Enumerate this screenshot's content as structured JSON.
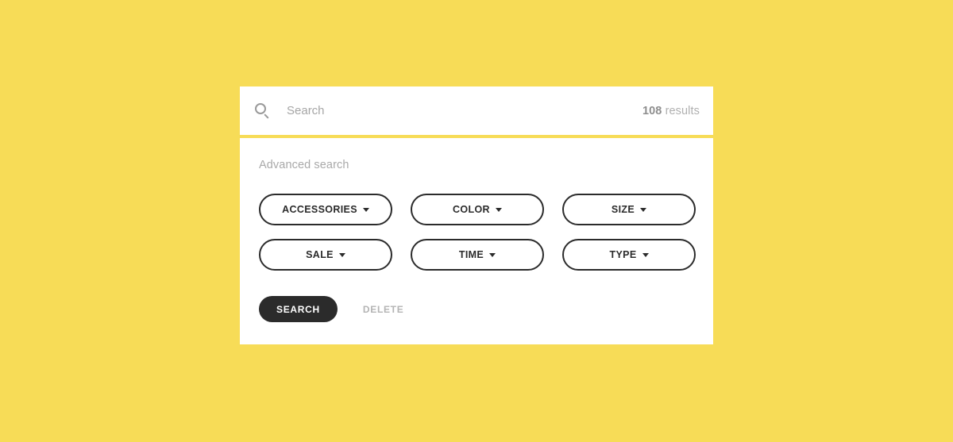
{
  "theme": {
    "background_color": "#f7dc57",
    "card_color": "#ffffff",
    "accent_dark": "#2b2b2b",
    "muted_text": "#a9a9a9"
  },
  "search": {
    "icon": "search-icon",
    "placeholder": "Search",
    "value": "",
    "results_count": "108",
    "results_label": "results"
  },
  "advanced": {
    "title": "Advanced search",
    "filters": [
      {
        "label": "ACCESSORIES",
        "icon": "chevron-down-icon"
      },
      {
        "label": "COLOR",
        "icon": "chevron-down-icon"
      },
      {
        "label": "SIZE",
        "icon": "chevron-down-icon"
      },
      {
        "label": "SALE",
        "icon": "chevron-down-icon"
      },
      {
        "label": "TIME",
        "icon": "chevron-down-icon"
      },
      {
        "label": "TYPE",
        "icon": "chevron-down-icon"
      }
    ],
    "actions": {
      "submit_label": "SEARCH",
      "clear_label": "DELETE"
    }
  }
}
